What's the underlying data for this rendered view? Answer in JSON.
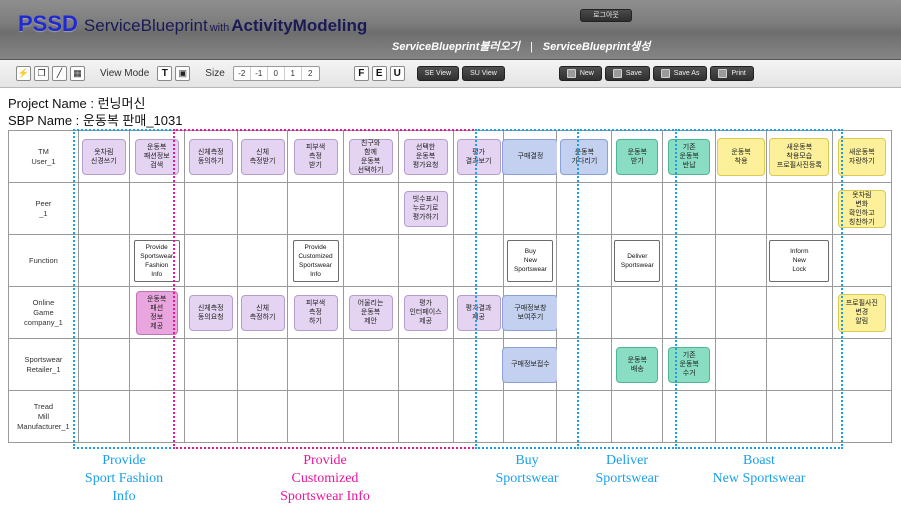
{
  "header": {
    "brand_acronym": "PSSD",
    "brand_title_1": "ServiceBlueprint",
    "brand_title_2": "with",
    "brand_title_3": "ActivityModeling",
    "logout_label": "로그아웃",
    "nav_load": "ServiceBlueprint불러오기",
    "nav_separator": "|",
    "nav_create": "ServiceBlueprint생성"
  },
  "toolbar": {
    "icons": [
      "shortcut-icon",
      "copy-icon",
      "pen-icon",
      "grid-icon"
    ],
    "icon_glyphs": [
      "⚡",
      "❐",
      "╱",
      "▦"
    ],
    "view_mode_label": "View Mode",
    "view_mode_text_glyph": "T",
    "view_mode_img_glyph": "▣",
    "size_label": "Size",
    "size_options": [
      "-2",
      "-1",
      "0",
      "1",
      "2"
    ],
    "letters": [
      "F",
      "E",
      "U"
    ],
    "se_view": "SE View",
    "su_view": "SU View",
    "new": "New",
    "save": "Save",
    "save_as": "Save As",
    "print": "Print"
  },
  "project": {
    "project_name_label": "Project Name : ",
    "project_name_value": "런닝머신",
    "sbp_name_label": "SBP Name : ",
    "sbp_name_value": "운동복 판매_1031"
  },
  "colors": {
    "purple": "#e4d4f2",
    "magenta": "#e9a5de",
    "blue": "#c3d0ef",
    "green": "#89ddc2",
    "yellow": "#fcf09a",
    "phase_blue": "#1aa0ea",
    "phase_pink": "#e8179a",
    "brand_blue": "#1f2ad0"
  },
  "rows": [
    {
      "label": "TM\nUser_1"
    },
    {
      "label": "Peer\n_1"
    },
    {
      "label": "Function"
    },
    {
      "label": "Online\nGame\ncompany_1"
    },
    {
      "label": "Sportswear\nRetailer_1"
    },
    {
      "label": "Tread\nMill\nManufacturer_1"
    }
  ],
  "activities": {
    "r1": [
      {
        "col": 1,
        "text": "옷차림\n신경쓰기",
        "color": "purple"
      },
      {
        "col": 2,
        "text": "운동복\n패션정보\n검색",
        "color": "purple"
      },
      {
        "col": 3,
        "text": "신체측정\n동의하기",
        "color": "purple"
      },
      {
        "col": 4,
        "text": "신체\n측정받기",
        "color": "purple"
      },
      {
        "col": 5,
        "text": "피부색\n측정\n받기",
        "color": "purple"
      },
      {
        "col": 6,
        "text": "친구와\n함께\n운동복\n선택하기",
        "color": "purple"
      },
      {
        "col": 7,
        "text": "선택한\n운동복\n평가요청",
        "color": "purple"
      },
      {
        "col": 8,
        "text": "평가\n결과보기",
        "color": "purple"
      },
      {
        "col": 9,
        "text": "구매결정",
        "color": "blue"
      },
      {
        "col": 10,
        "text": "운동복\n기다리기",
        "color": "blue"
      },
      {
        "col": 11,
        "text": "운동복\n받기",
        "color": "green"
      },
      {
        "col": 12,
        "text": "기존\n운동복\n반납",
        "color": "green"
      },
      {
        "col": 13,
        "text": "운동복\n착용",
        "color": "yellow"
      },
      {
        "col": 14,
        "text": "새운동복\n착용모습\n프로필사진등록",
        "color": "yellow"
      },
      {
        "col": 15,
        "text": "새운동복\n자랑하기",
        "color": "yellow"
      }
    ],
    "r2": [
      {
        "col": 7,
        "text": "빗수표시\n누르기로\n평가하기",
        "color": "purple"
      },
      {
        "col": 15,
        "text": "옷차림\n변화\n확인하고\n칭찬하기",
        "color": "yellow"
      }
    ],
    "r3": [
      {
        "col": 2,
        "text": "Provide\nSportswear\nFashion\nInfo",
        "color": "white"
      },
      {
        "col": 5,
        "text": "Provide\nCustomized\nSportswear\nInfo",
        "color": "white"
      },
      {
        "col": 9,
        "text": "Buy\nNew\nSportswear",
        "color": "white"
      },
      {
        "col": 11,
        "text": "Deliver\nSportswear",
        "color": "white"
      },
      {
        "col": 14,
        "text": "Inform\nNew\nLock",
        "color": "white"
      }
    ],
    "r4": [
      {
        "col": 2,
        "text": "운동복\n패션\n정보\n제공",
        "color": "magenta"
      },
      {
        "col": 3,
        "text": "신체측정\n동의요청",
        "color": "purple"
      },
      {
        "col": 4,
        "text": "신체\n측정하기",
        "color": "purple"
      },
      {
        "col": 5,
        "text": "피부색\n측정\n하기",
        "color": "purple"
      },
      {
        "col": 6,
        "text": "어울리는\n운동복\n제안",
        "color": "purple"
      },
      {
        "col": 7,
        "text": "평가\n인터페이스\n제공",
        "color": "purple"
      },
      {
        "col": 8,
        "text": "평가결과\n제공",
        "color": "purple"
      },
      {
        "col": 9,
        "text": "구매정보창\n보여주기",
        "color": "blue"
      },
      {
        "col": 15,
        "text": "프로필사진\n변경\n알림",
        "color": "yellow"
      }
    ],
    "r5": [
      {
        "col": 9,
        "text": "구매정보접수",
        "color": "blue"
      },
      {
        "col": 11,
        "text": "운동복\n배송",
        "color": "green"
      },
      {
        "col": 12,
        "text": "기존\n운동복\n수거",
        "color": "green"
      }
    ],
    "r6": []
  },
  "phases": [
    {
      "label": "Provide\nSport Fashion\nInfo",
      "color": "blue"
    },
    {
      "label": "Provide\nCustomized\nSportswear Info",
      "color": "pink"
    },
    {
      "label": "Buy\nSportswear",
      "color": "blue"
    },
    {
      "label": "Deliver\nSportswear",
      "color": "blue"
    },
    {
      "label": "Boast\nNew Sportswear",
      "color": "blue"
    }
  ]
}
